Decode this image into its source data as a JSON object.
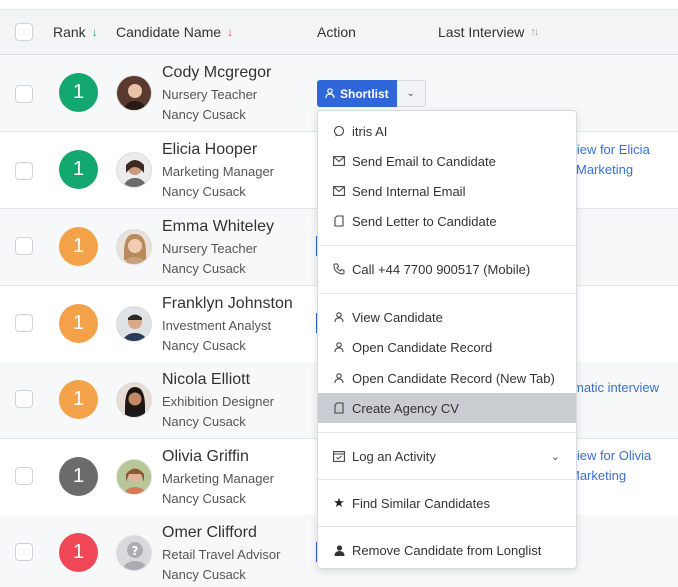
{
  "header": {
    "rank": "Rank",
    "candidate_name": "Candidate Name",
    "action": "Action",
    "last_interview": "Last Interview"
  },
  "rows": [
    {
      "rank": "1",
      "rank_color": "#12a86f",
      "name": "Cody Mcgregor",
      "title": "Nursery Teacher",
      "owner": "Nancy Cusack",
      "interview": ""
    },
    {
      "rank": "1",
      "rank_color": "#12a86f",
      "name": "Elicia Hooper",
      "title": "Marketing Manager",
      "owner": "Nancy Cusack",
      "interview": "rview for Elicia",
      "interview2": "Marketing"
    },
    {
      "rank": "1",
      "rank_color": "#f4a24a",
      "name": "Emma Whiteley",
      "title": "Nursery Teacher",
      "owner": "Nancy Cusack",
      "interview": ""
    },
    {
      "rank": "1",
      "rank_color": "#f4a24a",
      "name": "Franklyn Johnston",
      "title": "Investment Analyst",
      "owner": "Nancy Cusack",
      "interview": ""
    },
    {
      "rank": "1",
      "rank_color": "#f4a24a",
      "name": "Nicola Elliott",
      "title": "Exhibition Designer",
      "owner": "Nancy Cusack",
      "interview": "matic interview"
    },
    {
      "rank": "1",
      "rank_color": "#6b6b6b",
      "name": "Olivia Griffin",
      "title": "Marketing Manager",
      "owner": "Nancy Cusack",
      "interview": "rview for Olivia",
      "interview2": "Marketing"
    },
    {
      "rank": "1",
      "rank_color": "#ef4756",
      "name": "Omer Clifford",
      "title": "Retail Travel Advisor",
      "owner": "Nancy Cusack",
      "interview": ""
    }
  ],
  "shortlist": {
    "label": "Shortlist"
  },
  "menu": {
    "itris_ai": "itris AI",
    "send_email_candidate": "Send Email to Candidate",
    "send_internal_email": "Send Internal Email",
    "send_letter": "Send Letter to Candidate",
    "call": "Call +44 7700 900517 (Mobile)",
    "view_candidate": "View Candidate",
    "open_record": "Open Candidate Record",
    "open_record_new_tab": "Open Candidate Record (New Tab)",
    "create_cv": "Create Agency CV",
    "log_activity": "Log an Activity",
    "find_similar": "Find Similar Candidates",
    "remove_longlist": "Remove Candidate from Longlist"
  },
  "colors": {
    "primary": "#2f66d9",
    "highlight": "#c9ccd0",
    "link": "#3b6fd1"
  }
}
